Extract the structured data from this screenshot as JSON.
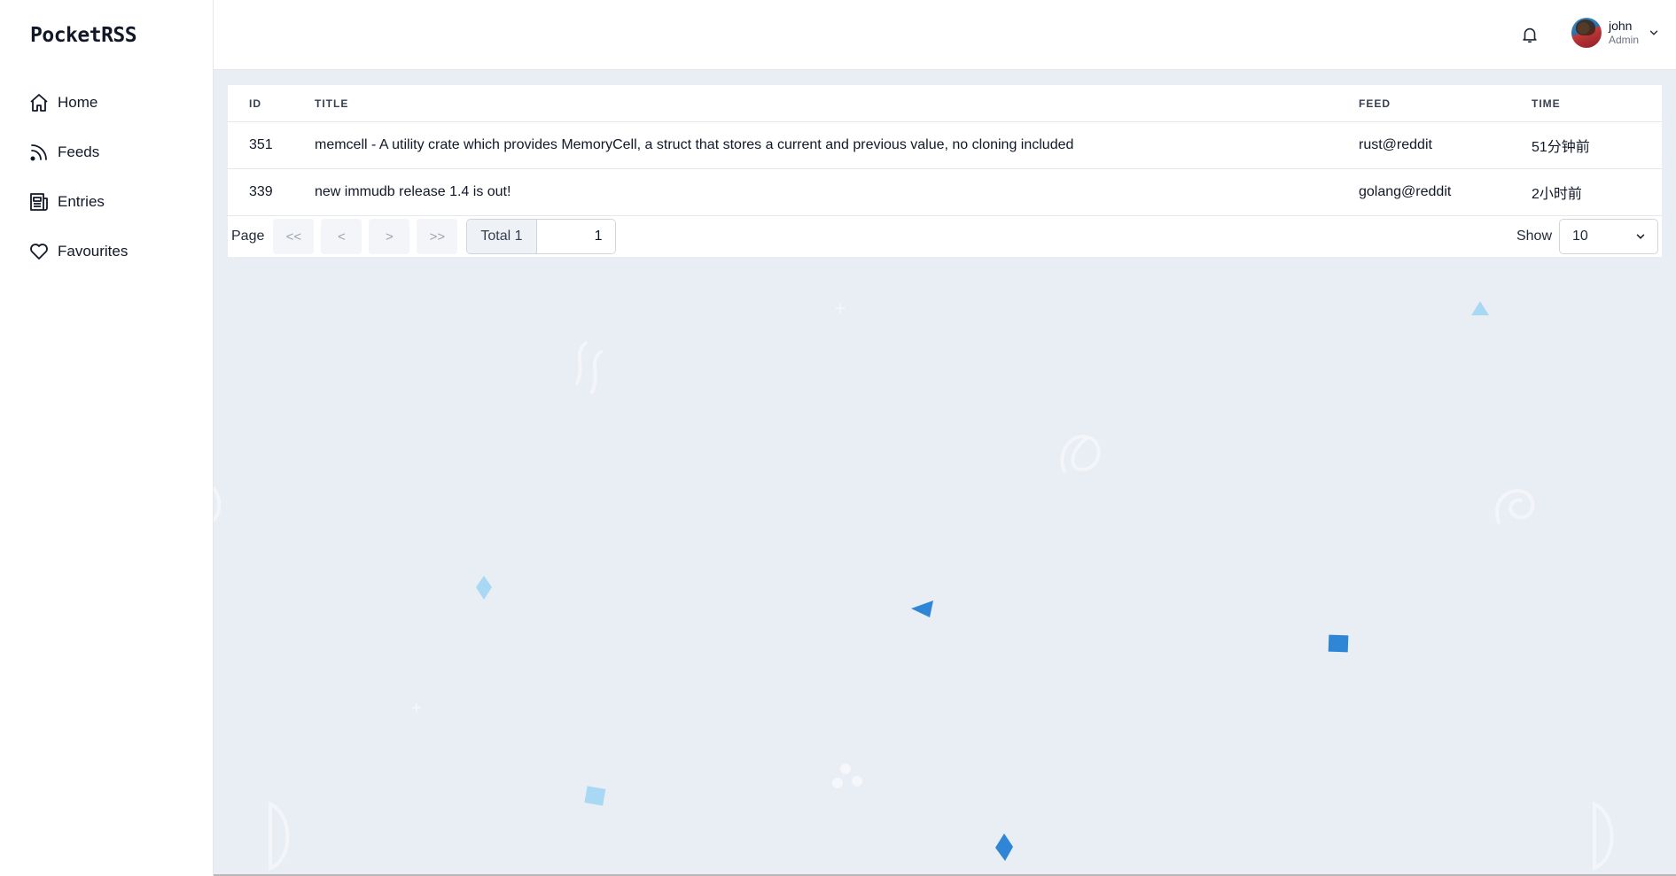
{
  "app": {
    "title": "PocketRSS"
  },
  "sidebar": {
    "items": [
      {
        "label": "Home",
        "icon": "home-icon"
      },
      {
        "label": "Feeds",
        "icon": "rss-icon"
      },
      {
        "label": "Entries",
        "icon": "newspaper-icon"
      },
      {
        "label": "Favourites",
        "icon": "heart-icon"
      }
    ]
  },
  "header": {
    "notifications_icon": "bell-icon",
    "user": {
      "name": "john",
      "role": "Admin"
    }
  },
  "table": {
    "columns": [
      "ID",
      "TITLE",
      "FEED",
      "TIME"
    ],
    "rows": [
      {
        "id": "351",
        "title": "memcell - A utility crate which provides MemoryCell, a struct that stores a current and previous value, no cloning included",
        "feed": "rust@reddit",
        "time": "51分钟前"
      },
      {
        "id": "339",
        "title": "new immudb release 1.4 is out!",
        "feed": "golang@reddit",
        "time": "2小时前"
      }
    ]
  },
  "pagination": {
    "label": "Page",
    "first": "<<",
    "prev": "<",
    "next": ">",
    "last": ">>",
    "total": "Total 1",
    "current": "1",
    "show_label": "Show",
    "page_size": "10"
  },
  "colors": {
    "accent": "#2f86d6",
    "light_accent": "#a6d4f2",
    "background": "#e9eef5"
  }
}
